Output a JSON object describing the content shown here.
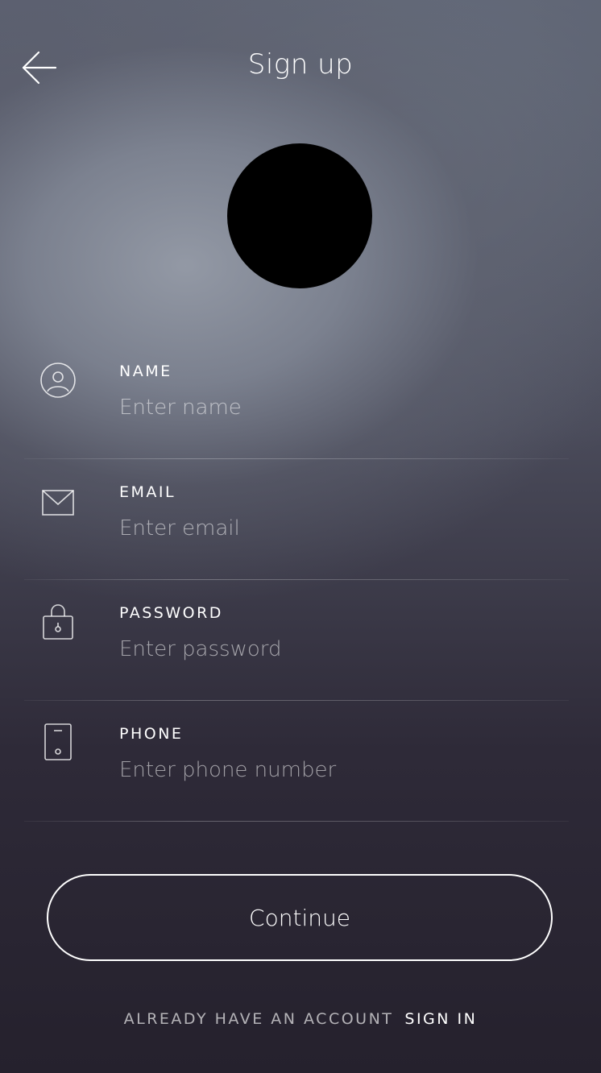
{
  "header": {
    "title": "Sign up",
    "back_icon": "arrow-left-icon"
  },
  "avatar": {
    "color": "#000000"
  },
  "form": {
    "fields": [
      {
        "label": "NAME",
        "placeholder": "Enter name",
        "value": "",
        "icon": "user-circle-icon"
      },
      {
        "label": "EMAIL",
        "placeholder": "Enter email",
        "value": "",
        "icon": "envelope-icon"
      },
      {
        "label": "PASSWORD",
        "placeholder": "Enter password",
        "value": "",
        "icon": "lock-icon"
      },
      {
        "label": "PHONE",
        "placeholder": "Enter phone number",
        "value": "",
        "icon": "phone-icon"
      }
    ]
  },
  "actions": {
    "continue_label": "Continue"
  },
  "footer": {
    "prompt": "ALREADY HAVE AN ACCOUNT",
    "signin_label": "SIGN IN"
  }
}
